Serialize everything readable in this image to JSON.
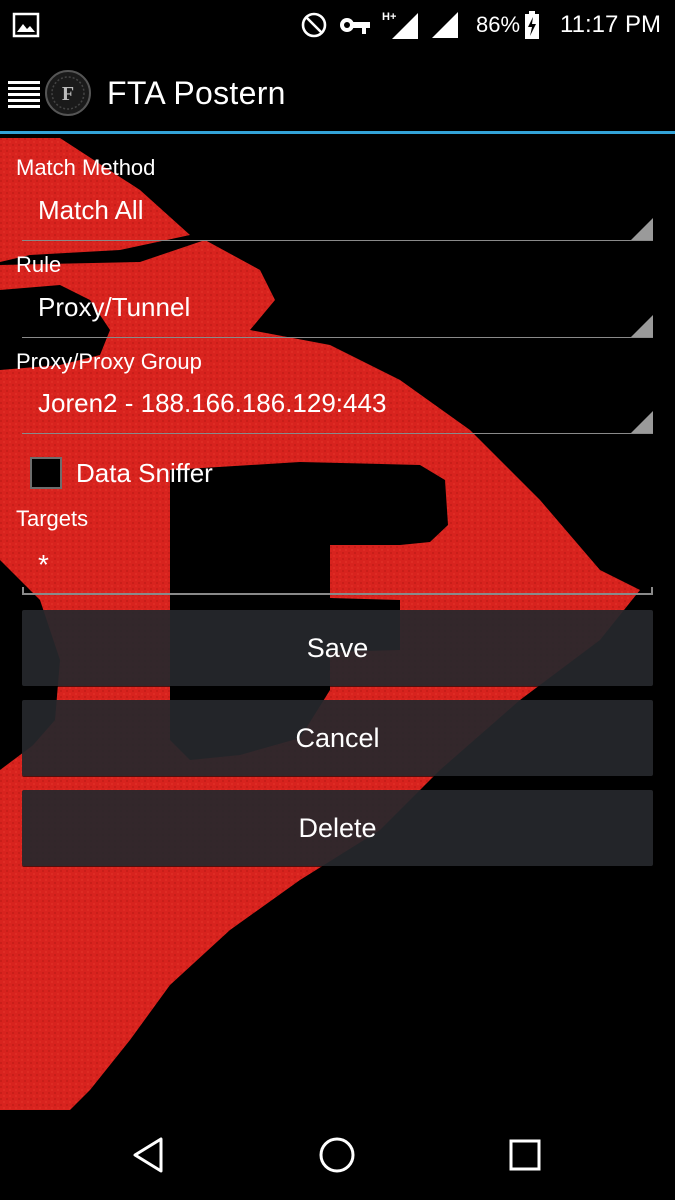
{
  "status_bar": {
    "notification_icon": "gallery-icon",
    "icons": [
      "do-not-disturb-icon",
      "vpn-key-icon",
      "signal-h-plus-icon",
      "signal-icon"
    ],
    "network_type": "H+",
    "battery_percent": "86%",
    "time": "11:17 PM"
  },
  "app_bar": {
    "title": "FTA Postern",
    "menu_icon": "hamburger-menu-icon",
    "logo_icon": "app-logo-icon",
    "divider_color": "#33a3d8"
  },
  "form": {
    "match_method": {
      "label": "Match Method",
      "value": "Match All"
    },
    "rule": {
      "label": "Rule",
      "value": "Proxy/Tunnel"
    },
    "proxy": {
      "label": "Proxy/Proxy Group",
      "value": "Joren2 - 188.166.186.129:443"
    },
    "data_sniffer": {
      "label": "Data Sniffer",
      "checked": false
    },
    "targets": {
      "label": "Targets",
      "value": "*"
    }
  },
  "buttons": {
    "save": "Save",
    "cancel": "Cancel",
    "delete": "Delete"
  },
  "nav_bar": {
    "icons": [
      "back-icon",
      "home-icon",
      "recents-icon"
    ]
  },
  "colors": {
    "background": "#000000",
    "artwork_red": "#d8231e",
    "button_bg": "#26282c",
    "accent": "#33a3d8"
  }
}
